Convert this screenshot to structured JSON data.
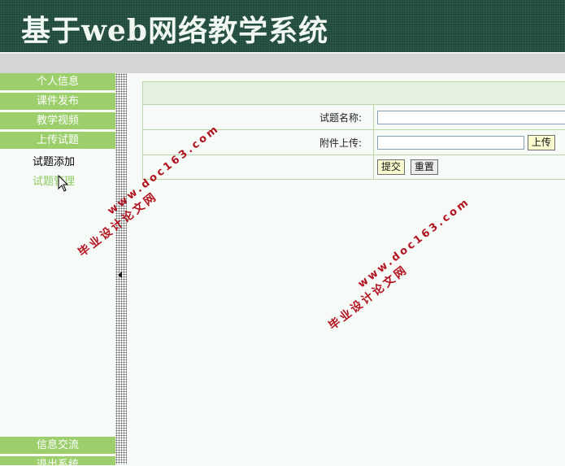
{
  "app": {
    "title": "基于web网络教学系统"
  },
  "sidebar": {
    "top_items": [
      {
        "label": "个人信息"
      },
      {
        "label": "课件发布"
      },
      {
        "label": "教学视频"
      },
      {
        "label": "上传试题"
      }
    ],
    "sub_items": [
      {
        "label": "试题添加",
        "color": "#000000"
      },
      {
        "label": "试题管理",
        "color": "#8fcb62"
      }
    ],
    "bottom_items": [
      {
        "label": "信息交流"
      },
      {
        "label": "退出系统"
      }
    ],
    "accent": "#9ccf6c"
  },
  "form": {
    "name_label": "试题名称:",
    "name_value": "",
    "attachment_label": "附件上传:",
    "attachment_value": "",
    "upload_label": "上传",
    "submit_label": "提交",
    "reset_label": "重置"
  },
  "watermark": {
    "line1": "毕业设计论文网",
    "line2": "www.doc163.com"
  }
}
